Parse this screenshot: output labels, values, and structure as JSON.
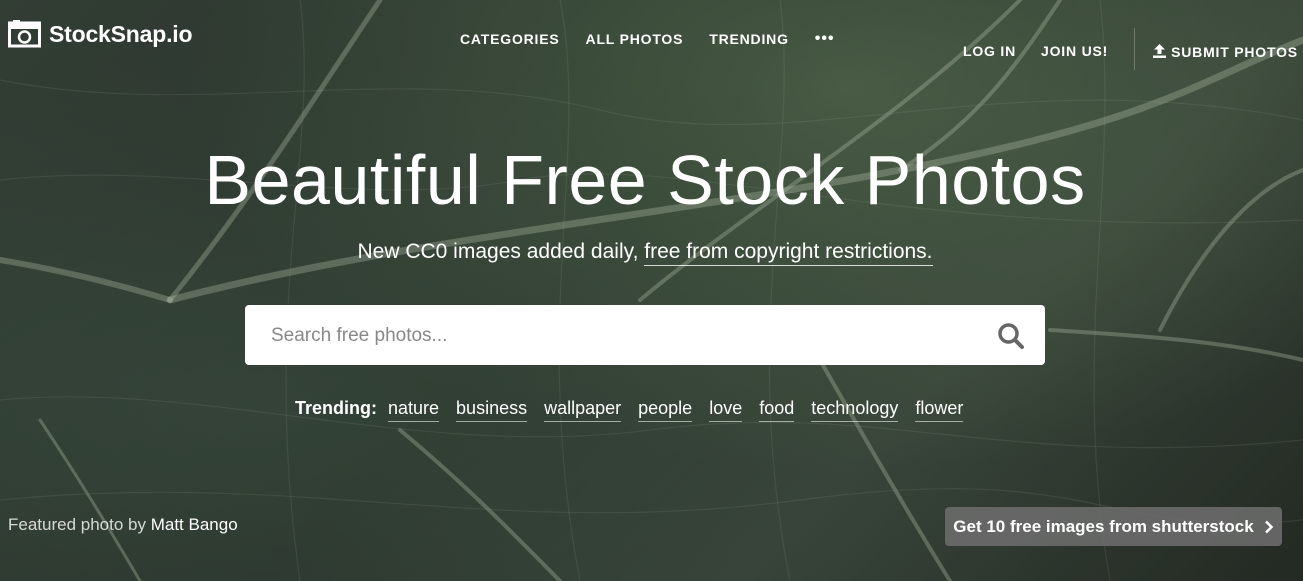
{
  "brand": {
    "name": "StockSnap.io"
  },
  "nav": {
    "center": [
      "CATEGORIES",
      "ALL PHOTOS",
      "TRENDING"
    ],
    "more": "•••",
    "right": [
      "LOG IN",
      "JOIN US!"
    ],
    "submit": "SUBMIT PHOTOS"
  },
  "hero": {
    "title": "Beautiful Free Stock Photos",
    "subtitle_plain": "New CC0 images added daily, ",
    "subtitle_link": "free from copyright restrictions."
  },
  "search": {
    "placeholder": "Search free photos..."
  },
  "trending": {
    "label": "Trending:",
    "tags": [
      "nature",
      "business",
      "wallpaper",
      "people",
      "love",
      "food",
      "technology",
      "flower"
    ]
  },
  "credit": {
    "prefix": "Featured photo by ",
    "author": "Matt Bango"
  },
  "promo": {
    "label": "Get 10 free images from shutterstock"
  },
  "icons": {
    "logo": "camera-icon",
    "search": "search-icon",
    "submit": "upload-icon",
    "promo": "chevron-right-icon"
  }
}
